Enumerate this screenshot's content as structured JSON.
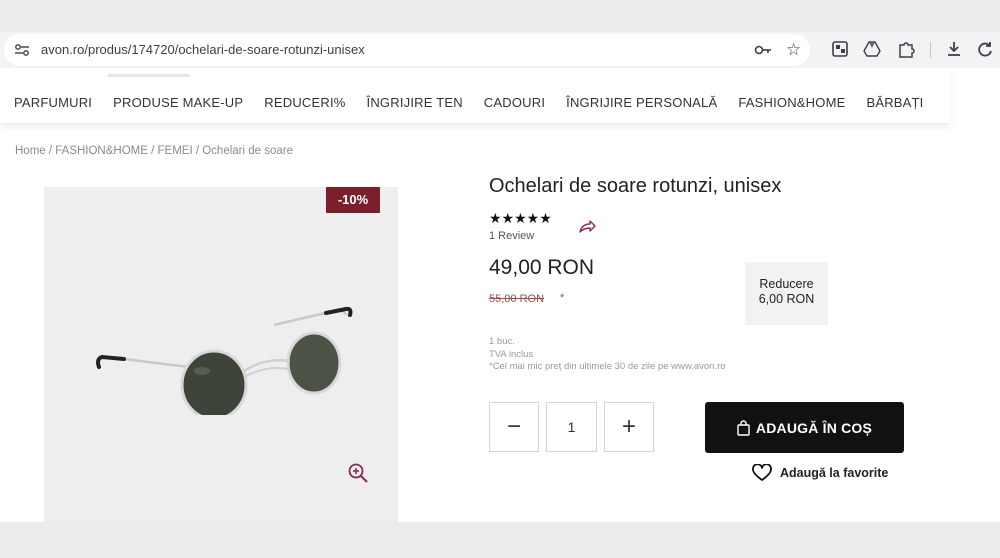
{
  "browser": {
    "url": "avon.ro/produs/174720/ochelari-de-soare-rotunzi-unisex",
    "icons": [
      "tune-icon",
      "key-icon",
      "bookmark-star-icon",
      "extension-icon",
      "drive-icon",
      "puzzle-icon",
      "download-icon",
      "refresh-icon"
    ]
  },
  "nav": {
    "items": [
      "PARFUMURI",
      "PRODUSE MAKE-UP",
      "REDUCERI%",
      "ÎNGRIJIRE TEN",
      "CADOURI",
      "ÎNGRIJIRE PERSONALĂ",
      "FASHION&HOME",
      "BĂRBAȚI"
    ]
  },
  "breadcrumb": "Home / FASHION&HOME / FEMEI / Ochelari de soare",
  "product": {
    "discount_badge": "-10%",
    "title": "Ochelari de soare rotunzi, unisex",
    "stars": "★★★★★",
    "rating": 5,
    "review_count": "1 Review",
    "price": "49,00 RON",
    "old_price": "55,00 RON",
    "old_price_mark": "*",
    "reducere_label": "Reducere",
    "reducere_value": "6,00 RON",
    "unit": "1 buc.",
    "vat": "TVA inclus",
    "lowest_price_note": "*Cel mai mic preț din ultimele 30 de zile pe www.avon.ro"
  },
  "cart": {
    "minus": "−",
    "quantity": "1",
    "plus": "+",
    "add_to_cart": "ADAUGĂ ÎN COȘ",
    "add_to_favorites": "Adaugă la favorite"
  },
  "colors": {
    "badge": "#7b1f2c",
    "button": "#111111",
    "zoom_icon": "#8a2a5a"
  }
}
